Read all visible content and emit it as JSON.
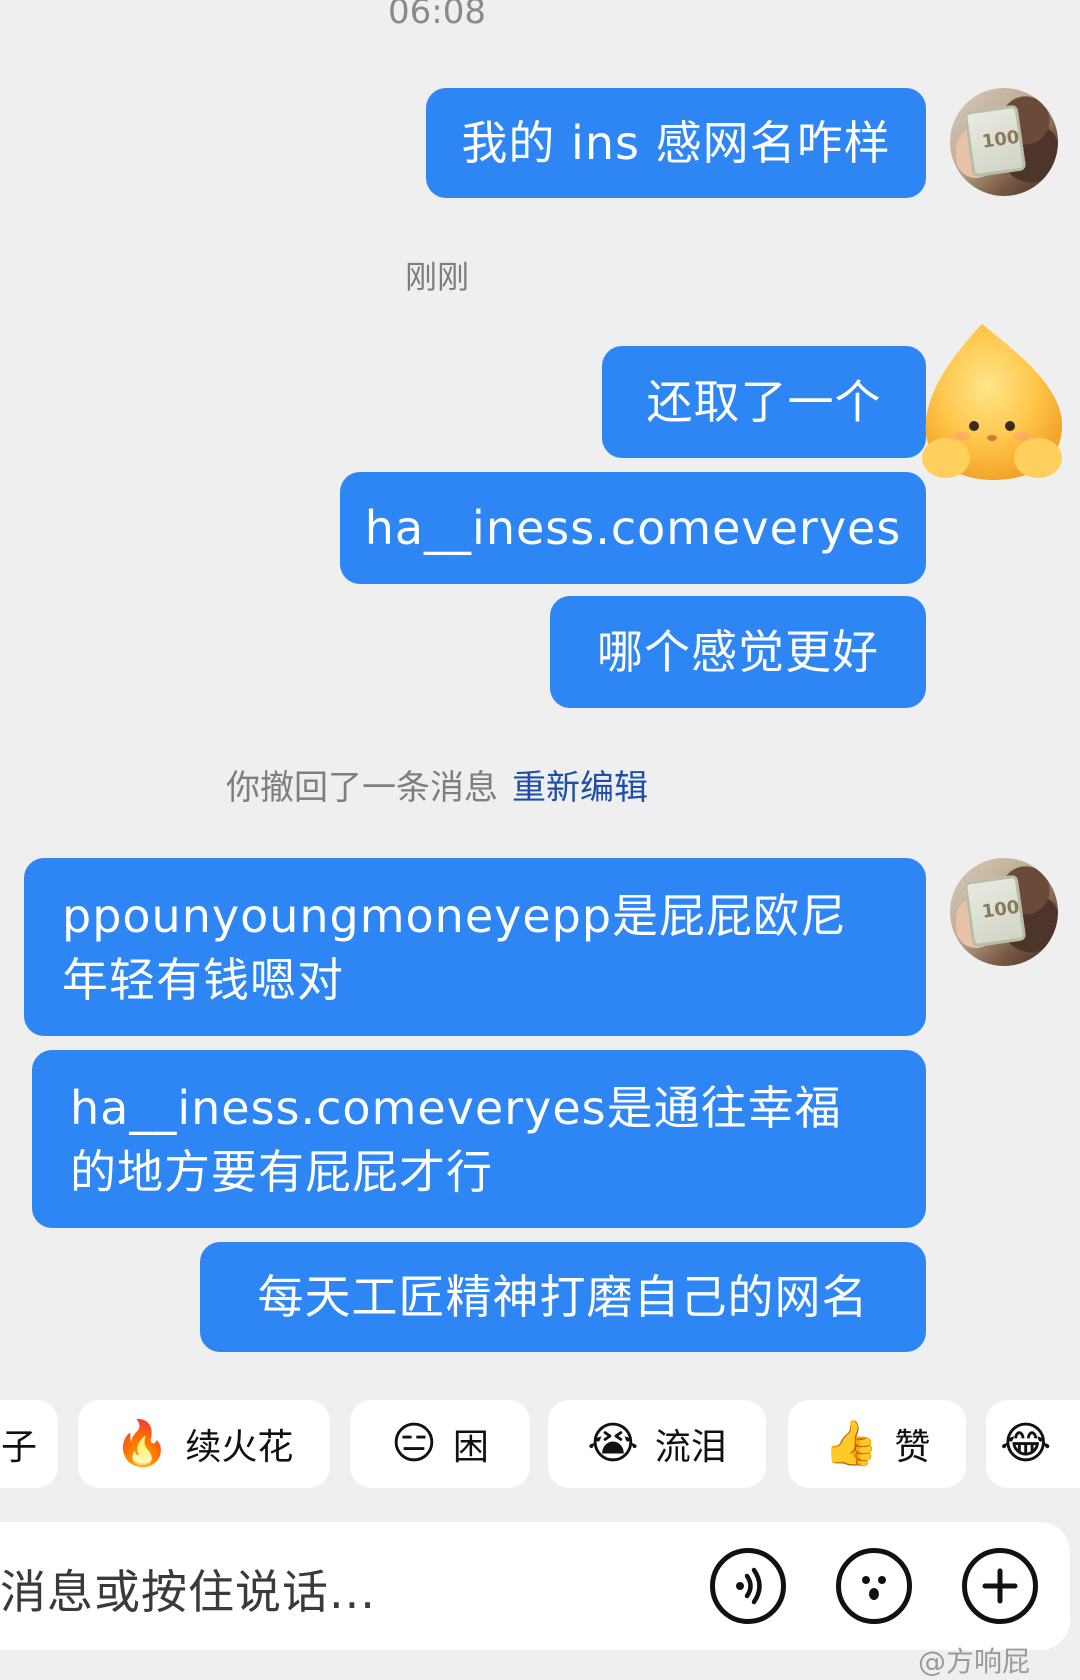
{
  "timestamps": {
    "top": "06:08",
    "middle": "刚刚"
  },
  "messages": [
    {
      "text": "我的 ins 感网名咋样"
    },
    {
      "text": "还取了一个"
    },
    {
      "text": "ha__iness.comeveryes"
    },
    {
      "text": "哪个感觉更好"
    },
    {
      "text": "ppounyoungmoneyepp是屁屁欧尼年轻有钱嗯对"
    },
    {
      "text": "ha__iness.comeveryes是通往幸福的地方要有屁屁才行"
    },
    {
      "text": "每天工匠精神打磨自己的网名"
    }
  ],
  "avatar_bill_text": "100",
  "recall": {
    "notice": "你撤回了一条消息",
    "action": "重新编辑"
  },
  "quick_replies": [
    {
      "label": "子",
      "icon": "partial-chip"
    },
    {
      "label": "续火花",
      "emoji": "🔥",
      "icon": "fire-icon"
    },
    {
      "label": "困",
      "emoji": "😑",
      "icon": "sleepy-face-icon"
    },
    {
      "label": "流泪",
      "emoji": "😭",
      "icon": "crying-face-icon"
    },
    {
      "label": "赞",
      "emoji": "👍",
      "icon": "thumbs-up-icon"
    },
    {
      "label": "",
      "emoji": "😂",
      "icon": "laughing-face-icon"
    }
  ],
  "input": {
    "placeholder": "消息或按住说话..."
  },
  "colors": {
    "bubble": "#2e86f5",
    "background": "#efeff0",
    "link": "#1d4fa8"
  },
  "watermark": "@方响屁"
}
